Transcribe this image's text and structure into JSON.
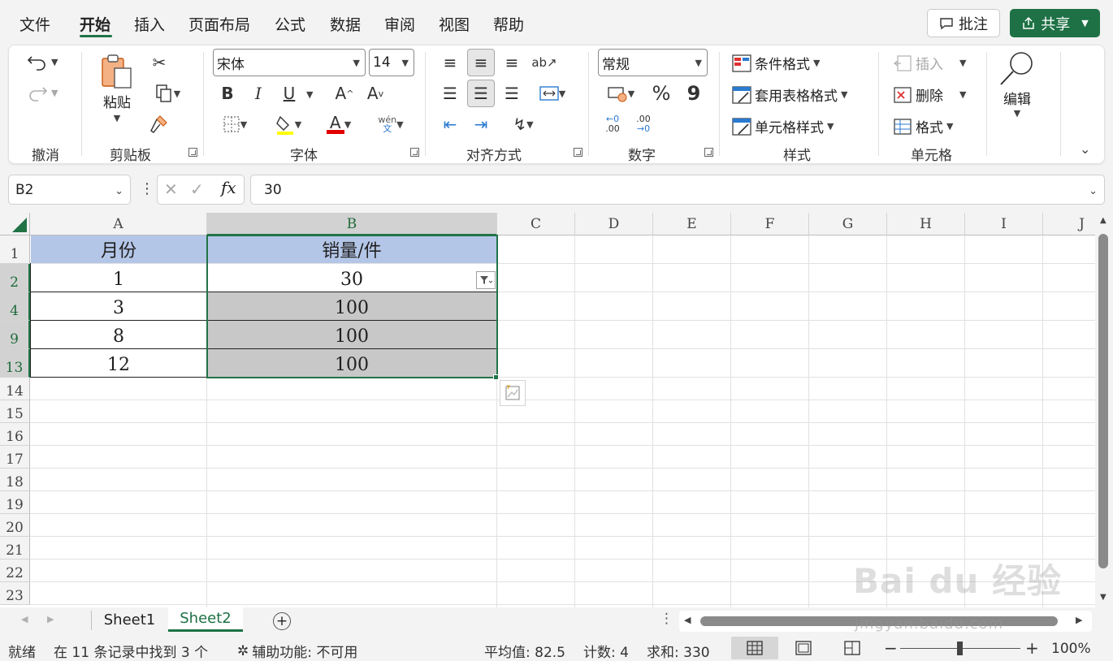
{
  "menu": {
    "items": [
      "文件",
      "开始",
      "插入",
      "页面布局",
      "公式",
      "数据",
      "审阅",
      "视图",
      "帮助"
    ],
    "active": "开始",
    "comment_label": "批注",
    "share_label": "共享"
  },
  "ribbon": {
    "groups": {
      "undo": "撤消",
      "clipboard": "剪贴板",
      "font": "字体",
      "alignment": "对齐方式",
      "number": "数字",
      "styles": "样式",
      "cells": "单元格"
    },
    "paste_label": "粘贴",
    "font_name": "宋体",
    "font_size": "14",
    "bold": "B",
    "italic": "I",
    "underline": "U",
    "grow_font": "A",
    "shrink_font": "A",
    "phonetic_top": "wén",
    "phonetic_bottom": "文",
    "font_color_letter": "A",
    "number_format": "常规",
    "percent": "%",
    "comma": "9",
    "inc_decimal_top": "←0",
    "inc_decimal_bottom": ".00",
    "dec_decimal_top": ".00",
    "dec_decimal_bottom": "→0",
    "conditional_format": "条件格式",
    "table_format": "套用表格格式",
    "cell_styles": "单元格样式",
    "insert": "插入",
    "delete": "删除",
    "format": "格式",
    "edit": "编辑"
  },
  "formula_bar": {
    "name_box": "B2",
    "fx": "fx",
    "value": "30"
  },
  "grid": {
    "columns": [
      "A",
      "B",
      "C",
      "D",
      "E",
      "F",
      "G",
      "H",
      "I",
      "J"
    ],
    "selected_column": "B",
    "rows": [
      {
        "num": "1",
        "a": "月份",
        "b": "销量/件"
      },
      {
        "num": "2",
        "a": "1",
        "b": "30"
      },
      {
        "num": "4",
        "a": "3",
        "b": "100"
      },
      {
        "num": "9",
        "a": "8",
        "b": "100"
      },
      {
        "num": "13",
        "a": "12",
        "b": "100"
      }
    ],
    "empty_rows": [
      "14",
      "15",
      "16",
      "17",
      "18",
      "19",
      "20",
      "21",
      "22",
      "23"
    ],
    "header_fill": "#b4c6e7",
    "selection_fill": "#c8c8c8",
    "accent": "#217346"
  },
  "sheets": {
    "tabs": [
      "Sheet1",
      "Sheet2"
    ],
    "active": "Sheet2"
  },
  "status": {
    "ready": "就绪",
    "filter_msg": "在 11 条记录中找到 3 个",
    "accessibility": "辅助功能: 不可用",
    "average": "平均值: 82.5",
    "count": "计数: 4",
    "sum": "求和: 330",
    "zoom_minus": "−",
    "zoom_plus": "+",
    "zoom": "100%"
  },
  "watermark": {
    "brand": "Bai du 经验",
    "url": "jingyan.baidu.com"
  }
}
